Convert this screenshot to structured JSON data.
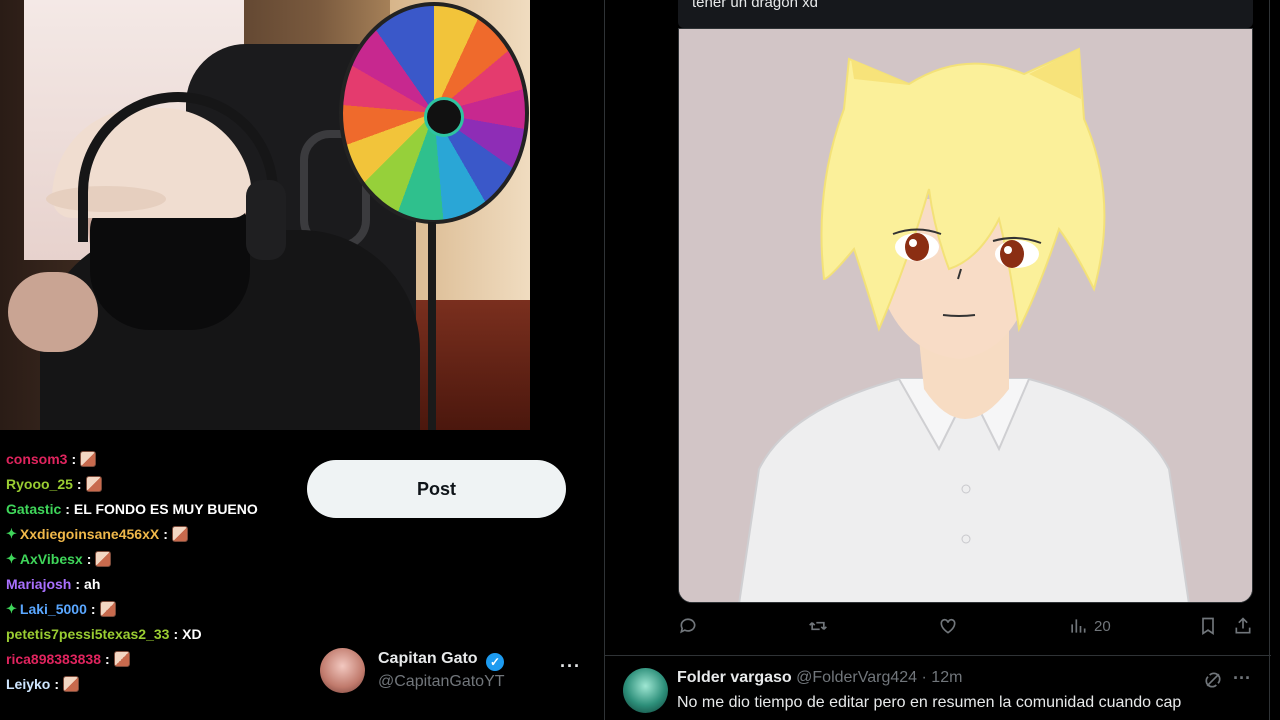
{
  "chat": {
    "messages": [
      {
        "user": "consom3",
        "color": "#e0245e",
        "badge": false,
        "text": "",
        "emote": true
      },
      {
        "user": "Ryooo_25",
        "color": "#9acd32",
        "badge": false,
        "text": "",
        "emote": true
      },
      {
        "user": "Gatastic",
        "color": "#3fd65a",
        "badge": false,
        "text": "EL FONDO ES MUY BUENO",
        "emote": false
      },
      {
        "user": "Xxdiegoinsane456xX",
        "color": "#f0b84a",
        "badge": true,
        "text": "",
        "emote": true
      },
      {
        "user": "AxVibesx",
        "color": "#3fd65a",
        "badge": true,
        "text": "",
        "emote": true
      },
      {
        "user": "Mariajosh",
        "color": "#a970ff",
        "badge": false,
        "text": "ah",
        "emote": false
      },
      {
        "user": "Laki_5000",
        "color": "#5aa7ff",
        "badge": true,
        "text": "",
        "emote": true
      },
      {
        "user": "petetis7pessi5texas2_33",
        "color": "#9acd32",
        "badge": false,
        "text": "XD",
        "emote": false
      },
      {
        "user": "rica898383838",
        "color": "#e0245e",
        "badge": false,
        "text": "",
        "emote": true
      },
      {
        "user": "Leiyko",
        "color": "#cfe6ff",
        "badge": false,
        "text": "",
        "emote": true
      }
    ]
  },
  "composer": {
    "post_label": "Post"
  },
  "account": {
    "name": "Capitan Gato",
    "handle": "@CapitanGatoYT",
    "more": "···"
  },
  "tweet": {
    "prev_text": "tener un dragon xd",
    "stats": {
      "views": "20"
    }
  },
  "reply": {
    "name": "Folder vargaso",
    "handle": "@FolderVarg424",
    "time": "· 12m",
    "text": "No me dio tiempo de editar pero en resumen la comunidad cuando cap",
    "more": "···"
  },
  "colors": {
    "accent": "#1d9bf0",
    "post_button": "#eff3f4",
    "muted": "#71767b"
  },
  "icons": [
    "reply-icon",
    "retweet-icon",
    "like-icon",
    "views-icon",
    "bookmark-icon",
    "share-icon",
    "grok-icon",
    "verified-icon"
  ]
}
